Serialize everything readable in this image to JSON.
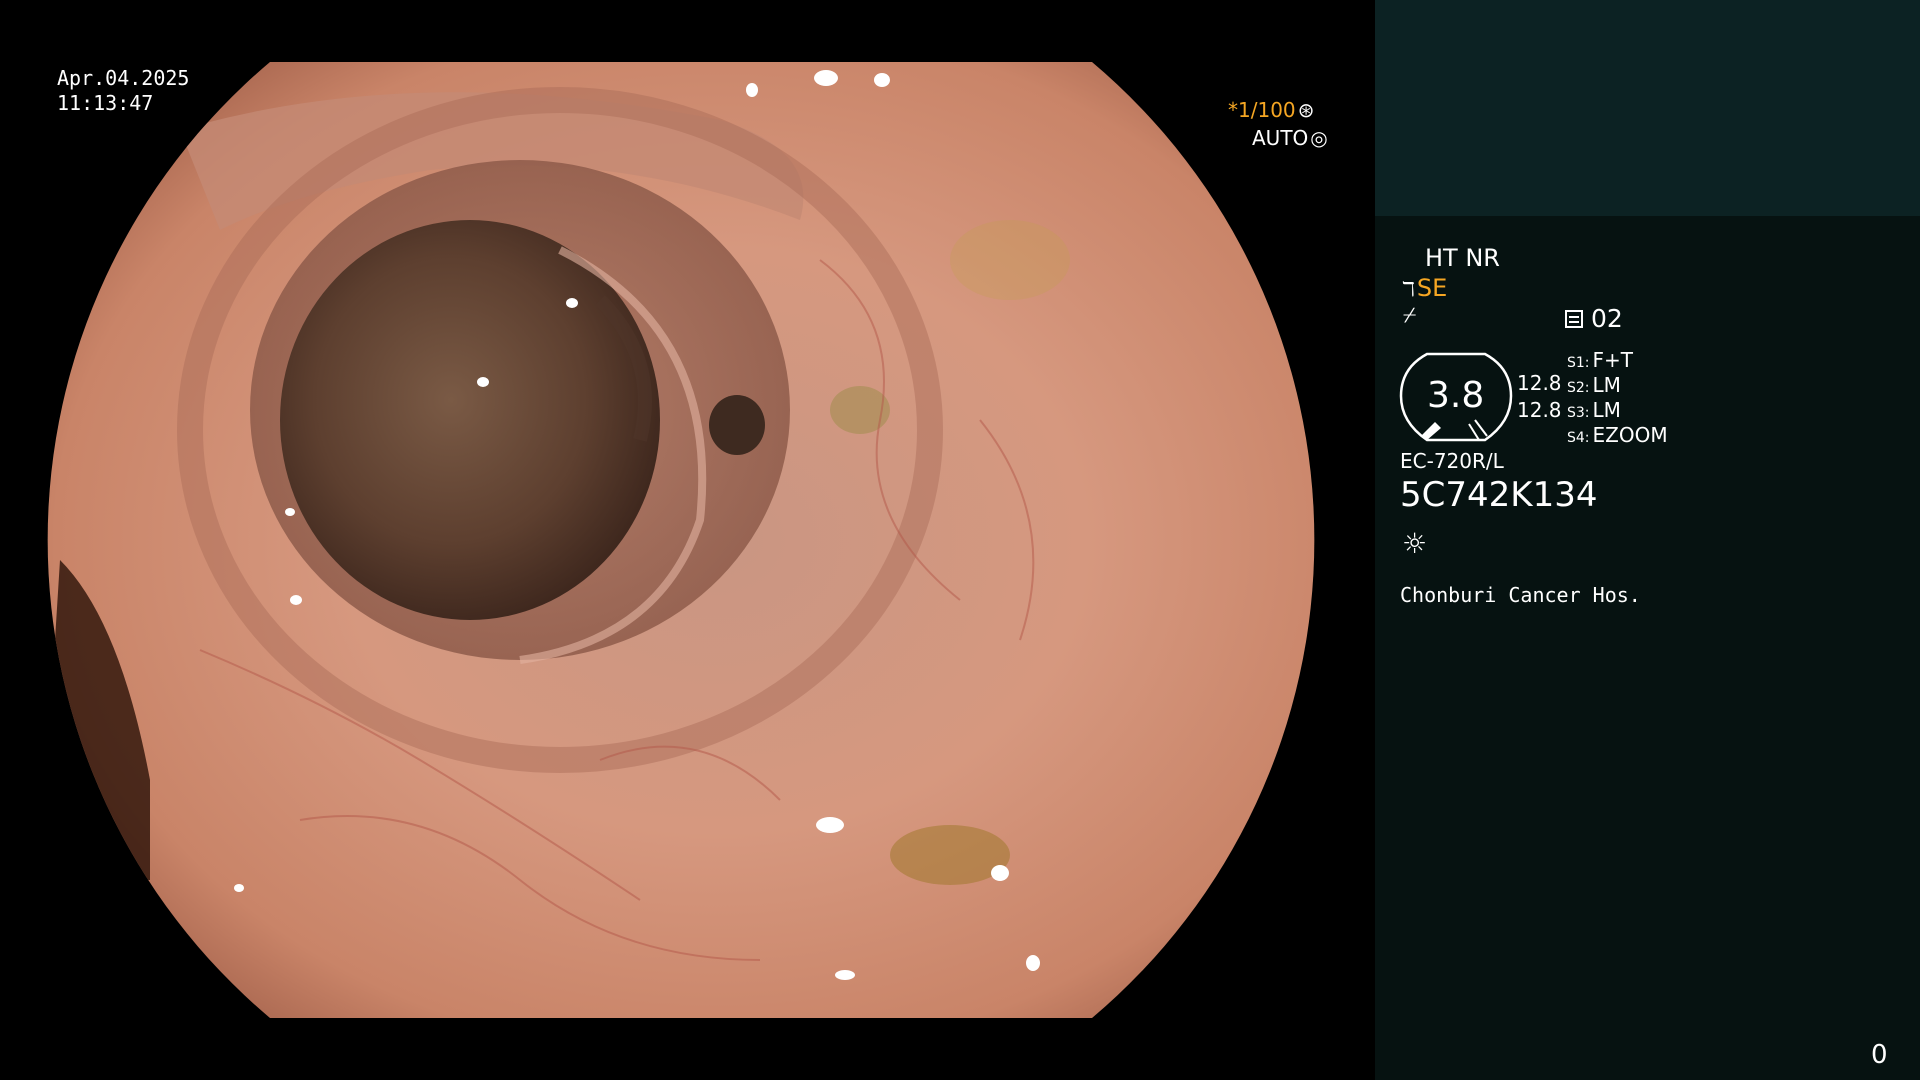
{
  "overlay": {
    "date": "Apr.04.2025",
    "time": "11:13:47",
    "shutter": "*1/100",
    "shutter_icon": "⊛",
    "iris": "AUTO",
    "iris_icon": "◎"
  },
  "panel": {
    "mode": "HT NR",
    "enhance_icon": "ℸ",
    "enhance": "SE",
    "slash_icon": "⌿",
    "memory": "02",
    "gauge_value": "3.8",
    "gauge_line1": "12.8",
    "gauge_line2": "12.8",
    "switches": [
      {
        "key": "S1:",
        "value": "F+T"
      },
      {
        "key": "S2:",
        "value": "LM"
      },
      {
        "key": "S3:",
        "value": "LM"
      },
      {
        "key": "S4:",
        "value": "EZOOM"
      }
    ],
    "scope_model": "EC-720R/L",
    "scope_serial": "5C742K134",
    "light_icon": "☼",
    "hospital": "Chonburi Cancer Hos.",
    "counter": "0"
  },
  "colors": {
    "accent": "#f5a623",
    "panel_top": "#0c2223",
    "panel_bottom": "#061211",
    "tissue": "#d4917a"
  }
}
